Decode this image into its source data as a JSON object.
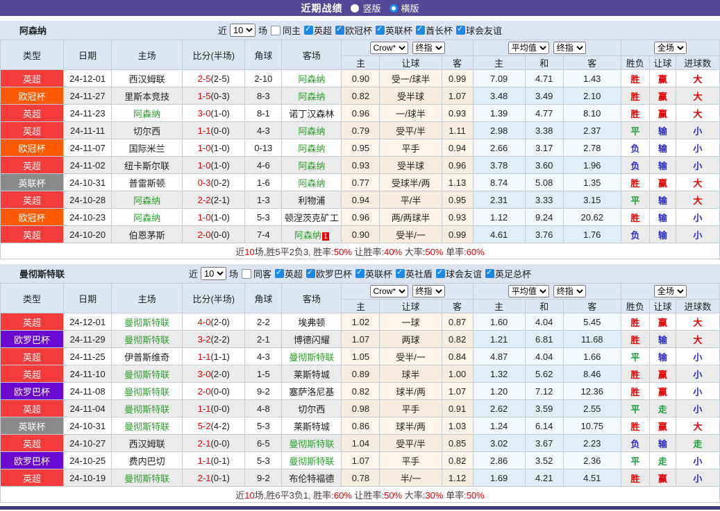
{
  "title_bar": {
    "title": "近期战绩",
    "orientation_options": [
      {
        "label": "竖版",
        "selected": false
      },
      {
        "label": "横版",
        "selected": true
      }
    ]
  },
  "table_headers": {
    "match_cols": [
      "类型",
      "日期",
      "主场",
      "比分(半场)",
      "角球",
      "客场"
    ],
    "odds_cols": [
      "主",
      "让球",
      "客"
    ],
    "avg_cols": [
      "主",
      "和",
      "客"
    ],
    "result_cols": [
      "胜负",
      "让球",
      "进球数"
    ]
  },
  "type_colors": {
    "英超": "#f43c3c",
    "欧冠杯": "#ff5a00",
    "英联杯": "#8a8a8a",
    "欧罗巴杯": "#6808d0"
  },
  "verdict_colors": {
    "胜": "red",
    "平": "green",
    "负": "blue",
    "赢": "red",
    "输": "blue",
    "走": "green",
    "大": "red",
    "小": "blue"
  },
  "status_palette": {
    "red": "#e60000",
    "green": "#1fa03c",
    "blue": "#2b2bd0",
    "team_green": "#2ca12c",
    "accent_blue": "#1e88e5",
    "bar_purple": "#524896"
  },
  "sections": [
    {
      "team": "阿森纳",
      "filter": {
        "prefix": "近",
        "games": "10",
        "suffix": "场",
        "same_venue": {
          "label": "同主",
          "checked": false
        },
        "leagues": [
          {
            "label": "英超",
            "checked": true
          },
          {
            "label": "欧冠杯",
            "checked": true
          },
          {
            "label": "英联杯",
            "checked": true
          },
          {
            "label": "酋长杯",
            "checked": true
          },
          {
            "label": "球会友谊",
            "checked": true
          }
        ]
      },
      "selectors": {
        "odds_source": "Crow*",
        "odds_final": "终指",
        "avg_label": "平均值",
        "avg_final": "终指",
        "scope": "全场"
      },
      "rows": [
        {
          "type": "英超",
          "date": "24-12-01",
          "home": "西汉姆联",
          "score": "2-5",
          "half": "(2-5)",
          "corners": "2-10",
          "away": "阿森纳",
          "o1": "0.90",
          "hc": "受一/球半",
          "o2": "0.99",
          "a1": "7.09",
          "a2": "4.71",
          "a3": "1.43",
          "r1": "胜",
          "r2": "赢",
          "r3": "大"
        },
        {
          "type": "欧冠杯",
          "date": "24-11-27",
          "home": "里斯本竞技",
          "score": "1-5",
          "half": "(0-3)",
          "corners": "8-3",
          "away": "阿森纳",
          "o1": "0.82",
          "hc": "受半球",
          "o2": "1.07",
          "a1": "3.48",
          "a2": "3.49",
          "a3": "2.10",
          "r1": "胜",
          "r2": "赢",
          "r3": "大"
        },
        {
          "type": "英超",
          "date": "24-11-23",
          "home": "阿森纳",
          "score": "3-0",
          "half": "(1-0)",
          "corners": "8-1",
          "away": "诺丁汉森林",
          "o1": "0.96",
          "hc": "一/球半",
          "o2": "0.93",
          "a1": "1.39",
          "a2": "4.77",
          "a3": "8.10",
          "r1": "胜",
          "r2": "赢",
          "r3": "大"
        },
        {
          "type": "英超",
          "date": "24-11-11",
          "home": "切尔西",
          "score": "1-1",
          "half": "(0-0)",
          "corners": "4-3",
          "away": "阿森纳",
          "o1": "0.79",
          "hc": "受平/半",
          "o2": "1.11",
          "a1": "2.98",
          "a2": "3.38",
          "a3": "2.37",
          "r1": "平",
          "r2": "输",
          "r3": "小"
        },
        {
          "type": "欧冠杯",
          "date": "24-11-07",
          "home": "国际米兰",
          "score": "1-0",
          "half": "(1-0)",
          "corners": "0-13",
          "away": "阿森纳",
          "o1": "0.95",
          "hc": "平手",
          "o2": "0.94",
          "a1": "2.66",
          "a2": "3.17",
          "a3": "2.78",
          "r1": "负",
          "r2": "输",
          "r3": "小"
        },
        {
          "type": "英超",
          "date": "24-11-02",
          "home": "纽卡斯尔联",
          "score": "1-0",
          "half": "(1-0)",
          "corners": "4-6",
          "away": "阿森纳",
          "o1": "0.93",
          "hc": "受半球",
          "o2": "0.96",
          "a1": "3.78",
          "a2": "3.60",
          "a3": "1.96",
          "r1": "负",
          "r2": "输",
          "r3": "小"
        },
        {
          "type": "英联杯",
          "date": "24-10-31",
          "home": "普雷斯顿",
          "score": "0-3",
          "half": "(0-2)",
          "corners": "1-6",
          "away": "阿森纳",
          "o1": "0.77",
          "hc": "受球半/两",
          "o2": "1.13",
          "a1": "8.74",
          "a2": "5.08",
          "a3": "1.35",
          "r1": "胜",
          "r2": "赢",
          "r3": "大"
        },
        {
          "type": "英超",
          "date": "24-10-28",
          "home": "阿森纳",
          "score": "2-2",
          "half": "(2-1)",
          "corners": "1-3",
          "away": "利物浦",
          "o1": "0.94",
          "hc": "平/半",
          "o2": "0.95",
          "a1": "2.31",
          "a2": "3.33",
          "a3": "3.15",
          "r1": "平",
          "r2": "输",
          "r3": "大"
        },
        {
          "type": "欧冠杯",
          "date": "24-10-23",
          "home": "阿森纳",
          "score": "1-0",
          "half": "(1-0)",
          "corners": "5-3",
          "away": "顿涅茨克矿工",
          "o1": "0.96",
          "hc": "两/两球半",
          "o2": "0.93",
          "a1": "1.12",
          "a2": "9.24",
          "a3": "20.62",
          "r1": "胜",
          "r2": "输",
          "r3": "小"
        },
        {
          "type": "英超",
          "date": "24-10-20",
          "home": "伯恩茅斯",
          "score": "2-0",
          "half": "(0-0)",
          "corners": "7-4",
          "away": "阿森纳",
          "away_badge": "1",
          "o1": "0.90",
          "hc": "受半/一",
          "o2": "0.99",
          "a1": "4.61",
          "a2": "3.76",
          "a3": "1.76",
          "r1": "负",
          "r2": "输",
          "r3": "小"
        }
      ],
      "summary": [
        {
          "t": "近"
        },
        {
          "t": "10",
          "red": true
        },
        {
          "t": "场,胜5平2负3, 胜率:"
        },
        {
          "t": "50%",
          "red": true
        },
        {
          "t": " 让胜率:"
        },
        {
          "t": "40%",
          "red": true
        },
        {
          "t": " 大率:"
        },
        {
          "t": "50%",
          "red": true
        },
        {
          "t": " 单率:"
        },
        {
          "t": "60%",
          "red": true
        }
      ]
    },
    {
      "team": "曼彻斯特联",
      "filter": {
        "prefix": "近",
        "games": "10",
        "suffix": "场",
        "same_venue": {
          "label": "同客",
          "checked": false
        },
        "leagues": [
          {
            "label": "英超",
            "checked": true
          },
          {
            "label": "欧罗巴杯",
            "checked": true
          },
          {
            "label": "英联杯",
            "checked": true
          },
          {
            "label": "英社盾",
            "checked": true
          },
          {
            "label": "球会友谊",
            "checked": true
          },
          {
            "label": "英足总杯",
            "checked": true
          }
        ]
      },
      "selectors": {
        "odds_source": "Crow*",
        "odds_final": "终指",
        "avg_label": "平均值",
        "avg_final": "终指",
        "scope": "全场"
      },
      "rows": [
        {
          "type": "英超",
          "date": "24-12-01",
          "home": "曼彻斯特联",
          "score": "4-0",
          "half": "(2-0)",
          "corners": "2-2",
          "away": "埃弗顿",
          "o1": "1.02",
          "hc": "一球",
          "o2": "0.87",
          "a1": "1.60",
          "a2": "4.04",
          "a3": "5.45",
          "r1": "胜",
          "r2": "赢",
          "r3": "大"
        },
        {
          "type": "欧罗巴杯",
          "date": "24-11-29",
          "home": "曼彻斯特联",
          "score": "3-2",
          "half": "(2-2)",
          "corners": "2-1",
          "away": "博德闪耀",
          "o1": "1.07",
          "hc": "两球",
          "o2": "0.82",
          "a1": "1.21",
          "a2": "6.81",
          "a3": "11.68",
          "r1": "胜",
          "r2": "输",
          "r3": "大"
        },
        {
          "type": "英超",
          "date": "24-11-25",
          "home": "伊普斯维奇",
          "score": "1-1",
          "half": "(1-1)",
          "corners": "4-3",
          "away": "曼彻斯特联",
          "o1": "1.05",
          "hc": "受半/一",
          "o2": "0.84",
          "a1": "4.87",
          "a2": "4.04",
          "a3": "1.66",
          "r1": "平",
          "r2": "输",
          "r3": "小"
        },
        {
          "type": "英超",
          "date": "24-11-10",
          "home": "曼彻斯特联",
          "score": "3-0",
          "half": "(2-0)",
          "corners": "1-5",
          "away": "莱斯特城",
          "o1": "0.89",
          "hc": "球半",
          "o2": "1.00",
          "a1": "1.32",
          "a2": "5.62",
          "a3": "8.46",
          "r1": "胜",
          "r2": "赢",
          "r3": "小"
        },
        {
          "type": "欧罗巴杯",
          "date": "24-11-08",
          "home": "曼彻斯特联",
          "score": "2-0",
          "half": "(0-0)",
          "corners": "9-2",
          "away": "塞萨洛尼基",
          "o1": "0.82",
          "hc": "球半/两",
          "o2": "1.07",
          "a1": "1.20",
          "a2": "7.12",
          "a3": "12.36",
          "r1": "胜",
          "r2": "赢",
          "r3": "小"
        },
        {
          "type": "英超",
          "date": "24-11-04",
          "home": "曼彻斯特联",
          "score": "1-1",
          "half": "(0-0)",
          "corners": "4-8",
          "away": "切尔西",
          "o1": "0.98",
          "hc": "平手",
          "o2": "0.91",
          "a1": "2.62",
          "a2": "3.59",
          "a3": "2.55",
          "r1": "平",
          "r2": "走",
          "r3": "小"
        },
        {
          "type": "英联杯",
          "date": "24-10-31",
          "home": "曼彻斯特联",
          "score": "5-2",
          "half": "(4-2)",
          "corners": "5-3",
          "away": "莱斯特城",
          "o1": "0.86",
          "hc": "球半/两",
          "o2": "1.03",
          "a1": "1.24",
          "a2": "6.14",
          "a3": "10.75",
          "r1": "胜",
          "r2": "赢",
          "r3": "大"
        },
        {
          "type": "英超",
          "date": "24-10-27",
          "home": "西汉姆联",
          "score": "2-1",
          "half": "(0-0)",
          "corners": "6-5",
          "away": "曼彻斯特联",
          "o1": "1.04",
          "hc": "受平/半",
          "o2": "0.85",
          "a1": "3.02",
          "a2": "3.67",
          "a3": "2.23",
          "r1": "负",
          "r2": "输",
          "r3": "走"
        },
        {
          "type": "欧罗巴杯",
          "date": "24-10-25",
          "home": "费内巴切",
          "score": "1-1",
          "half": "(0-1)",
          "corners": "5-3",
          "away": "曼彻斯特联",
          "o1": "1.07",
          "hc": "平手",
          "o2": "0.82",
          "a1": "2.86",
          "a2": "3.52",
          "a3": "2.36",
          "r1": "平",
          "r2": "走",
          "r3": "小"
        },
        {
          "type": "英超",
          "date": "24-10-19",
          "home": "曼彻斯特联",
          "score": "2-1",
          "half": "(0-1)",
          "corners": "9-2",
          "away": "布伦特福德",
          "o1": "0.78",
          "hc": "半/一",
          "o2": "1.12",
          "a1": "1.69",
          "a2": "4.21",
          "a3": "4.51",
          "r1": "胜",
          "r2": "赢",
          "r3": "小"
        }
      ],
      "summary": [
        {
          "t": "近"
        },
        {
          "t": "10",
          "red": true
        },
        {
          "t": "场,胜6平3负1, 胜率:"
        },
        {
          "t": "60%",
          "red": true
        },
        {
          "t": " 让胜率:"
        },
        {
          "t": "50%",
          "red": true
        },
        {
          "t": " 大率:"
        },
        {
          "t": "30%",
          "red": true
        },
        {
          "t": " 单率:"
        },
        {
          "t": "50%",
          "red": true
        }
      ]
    }
  ]
}
